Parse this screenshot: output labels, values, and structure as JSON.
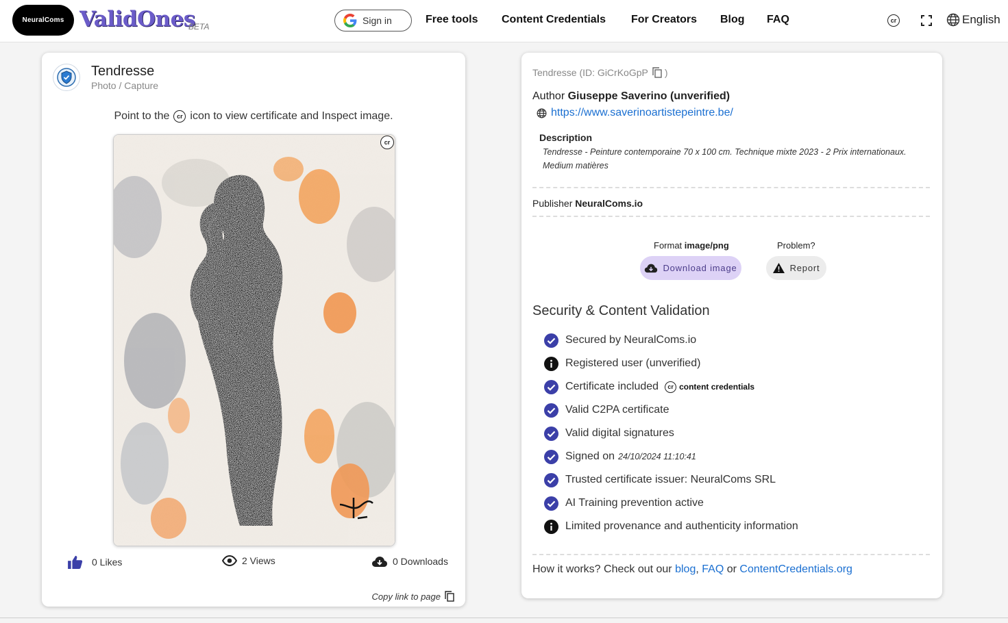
{
  "header": {
    "brand_pill": "NeuralComs",
    "logo": "ValidOnes",
    "beta": "BETA",
    "signin": "Sign in",
    "nav": [
      "Free tools",
      "Content Credentials",
      "For Creators",
      "Blog",
      "FAQ"
    ],
    "cr_icon_text": "cr",
    "language": "English"
  },
  "item": {
    "title": "Tendresse",
    "subtitle": "Photo / Capture",
    "point_before": "Point to the",
    "point_icon": "cr",
    "point_after": "icon to view certificate and Inspect image.",
    "corner_icon": "cr",
    "likes": "0 Likes",
    "views": "2 Views",
    "downloads": "0 Downloads",
    "copy_link": "Copy link to page"
  },
  "details": {
    "id_line_prefix": "Tendresse (ID: GiCrKoGpP",
    "id_line_suffix": ")",
    "author_label": "Author",
    "author_name": "Giuseppe Saverino (unverified)",
    "url": "https://www.saverinoartistepeintre.be/",
    "description_label": "Description",
    "description": "Tendresse - Peinture contemporaine 70 x 100 cm. Technique mixte 2023 - 2 Prix internationaux. Medium matières",
    "publisher_label": "Publisher",
    "publisher_name": "NeuralComs.io",
    "format_label": "Format",
    "format_value": "image/png",
    "problem_label": "Problem?",
    "download_button": "Download image",
    "report_button": "Report"
  },
  "validation": {
    "title": "Security & Content Validation",
    "items": [
      {
        "text": "Secured by NeuralComs.io",
        "status": "check"
      },
      {
        "text": "Registered user (unverified)",
        "status": "info"
      },
      {
        "text": "Certificate included",
        "status": "check",
        "badge_icon": "cr",
        "badge": "content credentials"
      },
      {
        "text": "Valid C2PA certificate",
        "status": "check"
      },
      {
        "text": "Valid digital signatures",
        "status": "check"
      },
      {
        "text": "Signed on",
        "status": "check",
        "date": "24/10/2024 11:10:41"
      },
      {
        "text": "Trusted certificate issuer: NeuralComs SRL",
        "status": "check"
      },
      {
        "text": "AI Training prevention active",
        "status": "check"
      },
      {
        "text": "Limited provenance and authenticity information",
        "status": "info"
      }
    ],
    "how_prefix": "How it works? Check out our",
    "link_blog": "blog",
    "sep1": ",",
    "link_faq": "FAQ",
    "sep2": "or",
    "link_cc": "ContentCredentials.org"
  },
  "colors": {
    "check": "#3b3fa8",
    "link": "#1a6fd1",
    "download_bg": "#ddd2f6",
    "logo": "#6b5cc9"
  }
}
